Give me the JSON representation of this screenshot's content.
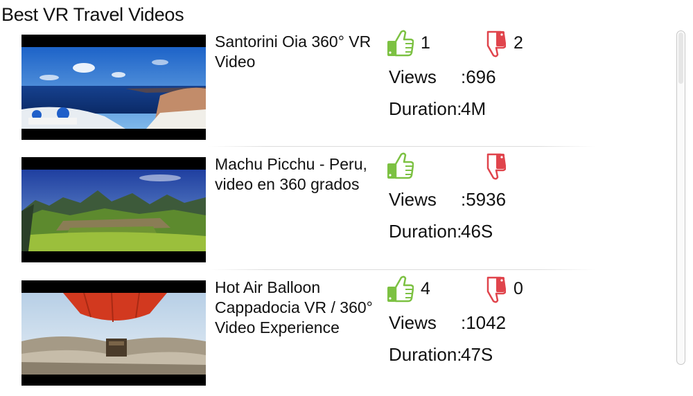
{
  "page": {
    "title": "Best VR Travel Videos"
  },
  "colors": {
    "like": "#7cc142",
    "dislike": "#e0444c"
  },
  "icons": {
    "like": "thumbs-up-icon",
    "dislike": "thumbs-down-icon"
  },
  "videos": [
    {
      "title": "Santorini Oia 360° VR Video",
      "likes": "1",
      "dislikes": "2",
      "views_label": "Views",
      "views_value": ":696",
      "duration_label": "Duration:",
      "duration_value": "4M"
    },
    {
      "title": "Machu Picchu - Peru, video en 360 grados",
      "likes": "",
      "dislikes": "",
      "views_label": "Views",
      "views_value": ":5936",
      "duration_label": "Duration:",
      "duration_value": "46S"
    },
    {
      "title": "Hot Air Balloon Cappadocia VR / 360° Video Experience",
      "likes": "4",
      "dislikes": "0",
      "views_label": "Views",
      "views_value": ":1042",
      "duration_label": "Duration:",
      "duration_value": "47S"
    }
  ]
}
